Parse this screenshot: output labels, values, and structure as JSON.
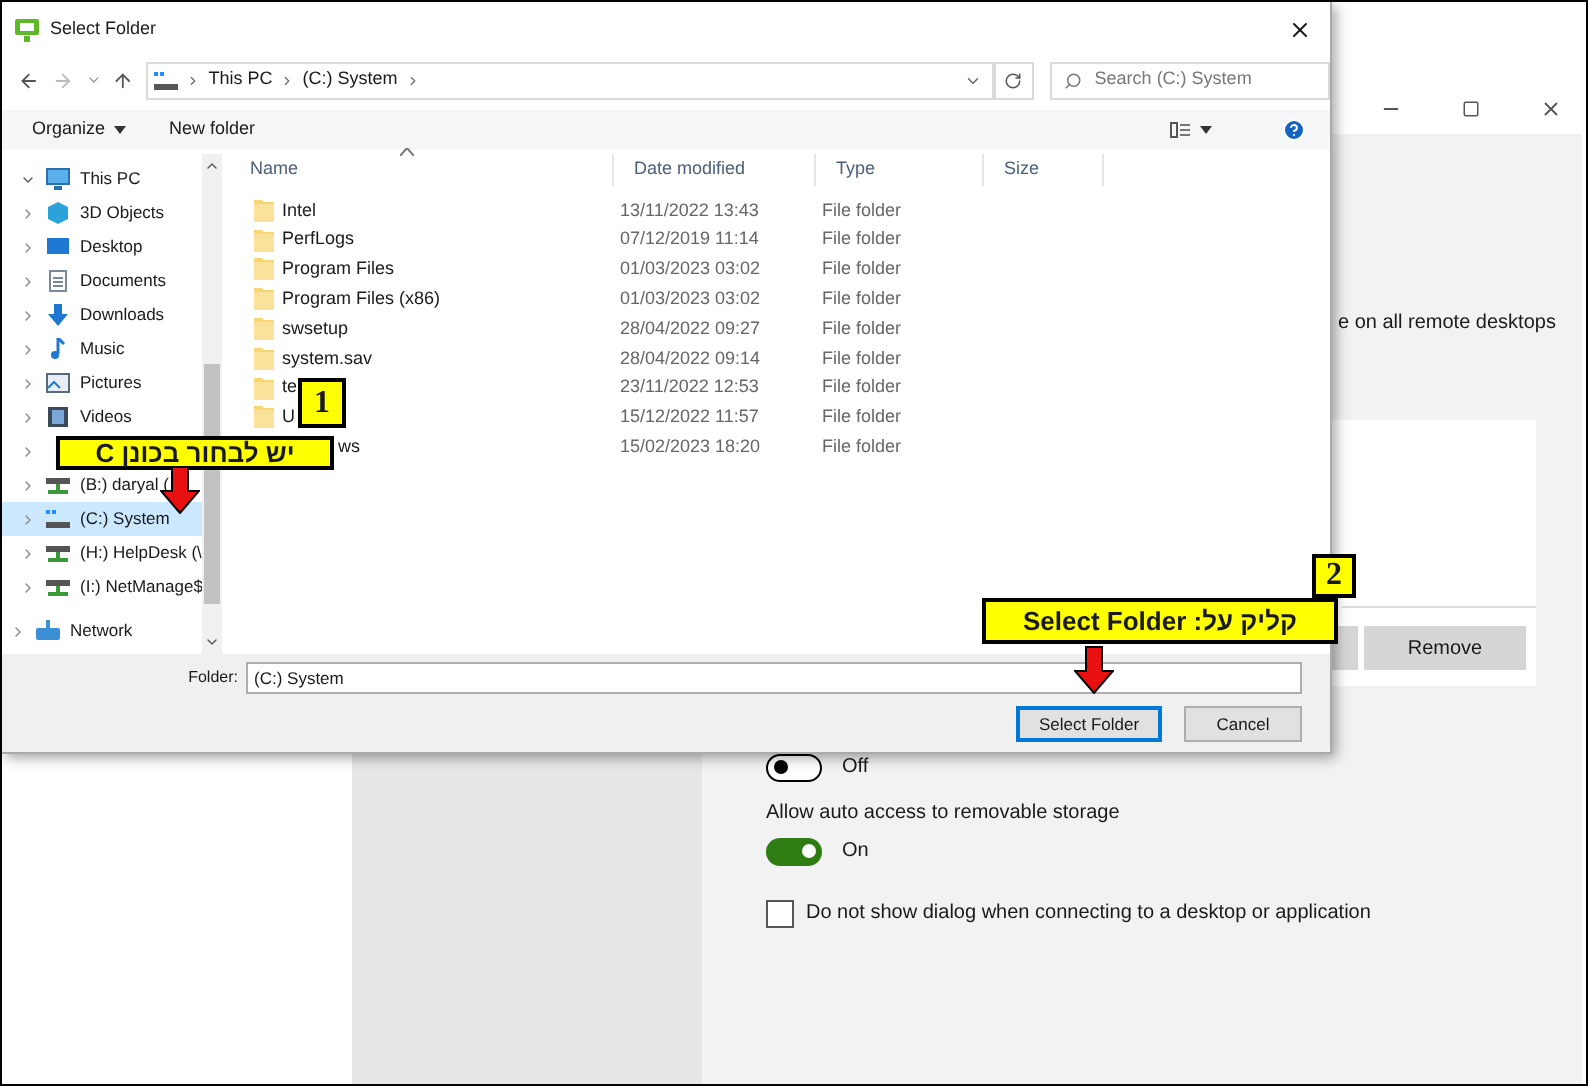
{
  "background": {
    "text_fragment": "e on all remote desktops",
    "remove_button": "Remove",
    "settings": [
      {
        "kind": "toggle",
        "on": false,
        "label": "Off"
      },
      {
        "kind": "heading",
        "label": "Allow auto access to removable storage"
      },
      {
        "kind": "toggle",
        "on": true,
        "label": "On"
      },
      {
        "kind": "checkbox",
        "checked": false,
        "label": "Do not show dialog when connecting to a desktop or application"
      }
    ]
  },
  "dialog": {
    "title": "Select Folder",
    "breadcrumbs": [
      "This PC",
      "(C:) System"
    ],
    "search": {
      "placeholder": "Search (C:) System"
    },
    "toolbar": [
      {
        "kind": "menu",
        "label": "Organize"
      },
      {
        "kind": "button",
        "label": "New folder"
      }
    ],
    "nav": [
      {
        "kind": "pc",
        "label": "This PC",
        "expanded": true,
        "selected": false
      },
      {
        "kind": "objects",
        "label": "3D Objects",
        "expanded": false,
        "selected": false
      },
      {
        "kind": "desktop",
        "label": "Desktop",
        "expanded": false,
        "selected": false
      },
      {
        "kind": "documents",
        "label": "Documents",
        "expanded": false,
        "selected": false
      },
      {
        "kind": "downloads",
        "label": "Downloads",
        "expanded": false,
        "selected": false
      },
      {
        "kind": "music",
        "label": "Music",
        "expanded": false,
        "selected": false
      },
      {
        "kind": "pictures",
        "label": "Pictures",
        "expanded": false,
        "selected": false
      },
      {
        "kind": "videos",
        "label": "Videos",
        "expanded": false,
        "selected": false
      },
      {
        "expanded": false,
        "selected": false
      },
      {
        "kind": "netdrive",
        "label": "(B:) daryal (",
        "expanded": false,
        "selected": false
      },
      {
        "kind": "sysdrive",
        "label": "(C:) System",
        "expanded": false,
        "selected": true
      },
      {
        "kind": "netdrive",
        "label": "(H:) HelpDesk (\\",
        "expanded": false,
        "selected": false
      },
      {
        "kind": "netdrive",
        "label": "(I:) NetManage$",
        "expanded": false,
        "selected": false
      },
      {
        "kind": "network",
        "label": "Network",
        "expanded": false,
        "selected": false
      }
    ],
    "columns": [
      "Name",
      "Date modified",
      "Type",
      "Size"
    ],
    "files": [
      {
        "name": "Intel",
        "date": "13/11/2022 13:43",
        "type": "File folder"
      },
      {
        "name": "PerfLogs",
        "date": "07/12/2019 11:14",
        "type": "File folder"
      },
      {
        "name": "Program Files",
        "date": "01/03/2023 03:02",
        "type": "File folder"
      },
      {
        "name": "Program Files (x86)",
        "date": "01/03/2023 03:02",
        "type": "File folder"
      },
      {
        "name": "swsetup",
        "date": "28/04/2022 09:27",
        "type": "File folder"
      },
      {
        "name": "system.sav",
        "date": "28/04/2022 09:14",
        "type": "File folder"
      },
      {
        "name": "te",
        "date": "23/11/2022 12:53",
        "type": "File folder"
      },
      {
        "name": "U",
        "date": "15/12/2022 11:57",
        "type": "File folder"
      },
      {
        "name": "ws",
        "kind": "covered_start",
        "date": "15/02/2023 18:20",
        "type": "File folder"
      }
    ],
    "folder_field": {
      "label": "Folder:",
      "value": "(C:) System"
    },
    "buttons": [
      {
        "label": "Select Folder",
        "focused": true
      },
      {
        "label": "Cancel",
        "focused": false
      }
    ]
  },
  "annotations": [
    {
      "number": "1",
      "text": "יש לבחור בכונן C"
    },
    {
      "number": "2",
      "text": "קליק על: Select Folder"
    }
  ]
}
